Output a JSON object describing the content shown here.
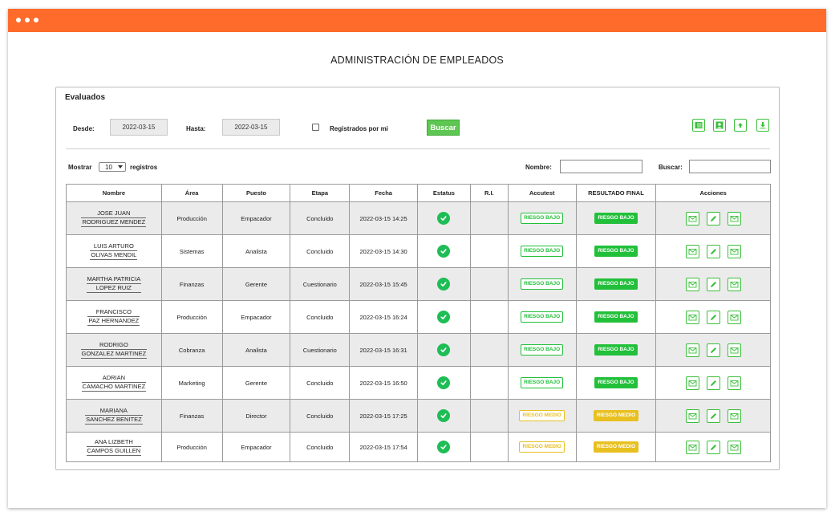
{
  "colors": {
    "titlebar": "#ff6b2a",
    "green": "#22c03a",
    "yellow": "#e8c020",
    "status_green": "#1ebd55"
  },
  "page_title": "ADMINISTRACIÓN DE EMPLEADOS",
  "panel": {
    "title": "Evaluados",
    "desde_label": "Desde:",
    "desde_value": "2022-03-15",
    "hasta_label": "Hasta:",
    "hasta_value": "2022-03-15",
    "registrados_label": "Registrados por mi",
    "buscar_button": "Buscar",
    "toolbar_icons": [
      "list-icon",
      "user-icon",
      "upload-icon",
      "download-icon"
    ],
    "mostrar_label": "Mostrar",
    "mostrar_value": "10",
    "registros_label": "registros",
    "nombre_label": "Nombre:",
    "buscar_label": "Buscar:"
  },
  "table": {
    "headers": [
      "Nombre",
      "Área",
      "Puesto",
      "Etapa",
      "Fecha",
      "Estatus",
      "R.I.",
      "Accutest",
      "RESULTADO FINAL",
      "Acciones"
    ],
    "rows": [
      {
        "name1": "JOSE JUAN",
        "name2": "RODRIGUEZ MENDEZ",
        "area": "Producción",
        "puesto": "Empacador",
        "etapa": "Concluido",
        "fecha": "2022-03-15 14:25",
        "ri": "",
        "accutest": "RIESGO BAJO",
        "resultado": "RIESGO BAJO",
        "level": "bajo"
      },
      {
        "name1": "LUIS ARTURO",
        "name2": "OLIVAS MENDIL",
        "area": "Sistemas",
        "puesto": "Analista",
        "etapa": "Concluido",
        "fecha": "2022-03-15 14:30",
        "ri": "",
        "accutest": "RIESGO BAJO",
        "resultado": "RIESGO BAJO",
        "level": "bajo"
      },
      {
        "name1": "MARTHA PATRICIA",
        "name2": "LOPEZ RUIZ",
        "area": "Finanzas",
        "puesto": "Gerente",
        "etapa": "Cuestionario",
        "fecha": "2022-03-15 15:45",
        "ri": "",
        "accutest": "RIESGO BAJO",
        "resultado": "RIESGO BAJO",
        "level": "bajo"
      },
      {
        "name1": "FRANCISCO",
        "name2": "PAZ HERNANDEZ",
        "area": "Producción",
        "puesto": "Empacador",
        "etapa": "Concluido",
        "fecha": "2022-03-15 16:24",
        "ri": "",
        "accutest": "RIESGO BAJO",
        "resultado": "RIESGO BAJO",
        "level": "bajo"
      },
      {
        "name1": "RODRIGO",
        "name2": "GONZALEZ MARTINEZ",
        "area": "Cobranza",
        "puesto": "Analista",
        "etapa": "Cuestionario",
        "fecha": "2022-03-15 16:31",
        "ri": "",
        "accutest": "RIESGO BAJO",
        "resultado": "RIESGO BAJO",
        "level": "bajo"
      },
      {
        "name1": "ADRIAN",
        "name2": "CAMACHO MARTINEZ",
        "area": "Marketing",
        "puesto": "Gerente",
        "etapa": "Concluido",
        "fecha": "2022-03-15 16:50",
        "ri": "",
        "accutest": "RIESGO BAJO",
        "resultado": "RIESGO BAJO",
        "level": "bajo"
      },
      {
        "name1": "MARIANA",
        "name2": "SANCHEZ BENITEZ",
        "area": "Finanzas",
        "puesto": "Director",
        "etapa": "Concluido",
        "fecha": "2022-03-15 17:25",
        "ri": "",
        "accutest": "RIESGO MEDIO",
        "resultado": "RIESGO MEDIO",
        "level": "medio"
      },
      {
        "name1": "ANA LIZBETH",
        "name2": "CAMPOS GUILLEN",
        "area": "Producción",
        "puesto": "Empacador",
        "etapa": "Concluido",
        "fecha": "2022-03-15 17:54",
        "ri": "",
        "accutest": "RIESGO MEDIO",
        "resultado": "RIESGO MEDIO",
        "level": "medio"
      }
    ],
    "row_icons": {
      "status": "check-circle-icon",
      "actions": [
        "mail-icon",
        "edit-pencil-icon",
        "mail-icon"
      ]
    }
  }
}
